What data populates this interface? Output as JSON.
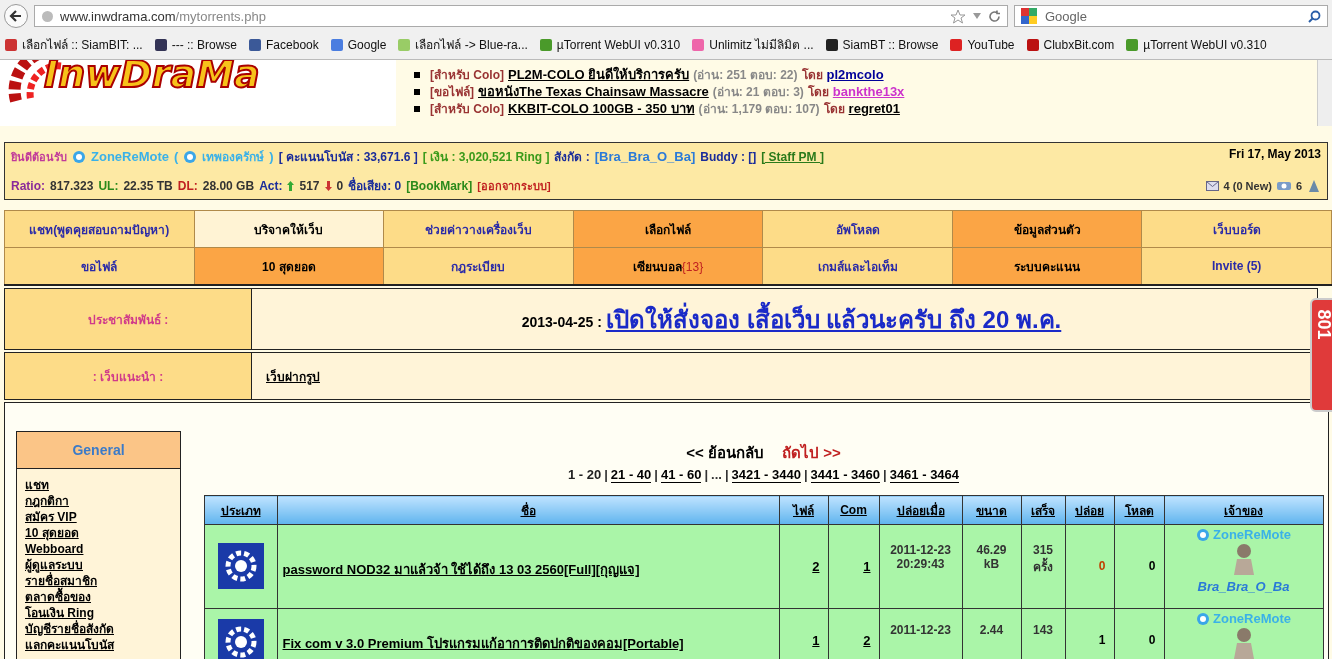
{
  "browser": {
    "address_host": "www.inwdrama.com",
    "address_path": "/mytorrents.php",
    "search_placeholder": "Google",
    "bookmarks": [
      {
        "label": "เลือกไฟล์ :: SiamBIT: ...",
        "kind": "flag"
      },
      {
        "label": "--- :: Browse",
        "kind": "shield"
      },
      {
        "label": "Facebook",
        "kind": "facebook"
      },
      {
        "label": "Google",
        "kind": "google"
      },
      {
        "label": "เลือกไฟล์ -> Blue-ra...",
        "kind": "android"
      },
      {
        "label": "µTorrent WebUI v0.310",
        "kind": "utorrent"
      },
      {
        "label": "Unlimitz ไม่มีลิมิต ...",
        "kind": "colorful"
      },
      {
        "label": "SiamBT :: Browse",
        "kind": "x"
      },
      {
        "label": "YouTube",
        "kind": "youtube"
      },
      {
        "label": "ClubxBit.com",
        "kind": "clubx"
      },
      {
        "label": "µTorrent WebUI v0.310",
        "kind": "utorrent"
      }
    ]
  },
  "logo": "InwDraMa",
  "news": [
    {
      "tag": "[สำหรับ Colo]",
      "title": "PL2M-COLO ยินดีให้บริการครับ",
      "stats": "(อ่าน: 251 ตอบ: 22)",
      "by": "โดย",
      "author": "pl2mcolo",
      "color": "#000099"
    },
    {
      "tag": "[ขอไฟล์]",
      "title": "ขอหนังThe Texas Chainsaw Massacre",
      "stats": "(อ่าน: 21 ตอบ: 3)",
      "by": "โดย",
      "author": "bankthe13x",
      "color": "#cc33cc"
    },
    {
      "tag": "[สำหรับ Colo]",
      "title": "KKBIT-COLO 100GB - 350 บาท",
      "stats": "(อ่าน: 1,179 ตอบ: 107)",
      "by": "โดย",
      "author": "regret01",
      "color": "#000000"
    }
  ],
  "user_bar": {
    "welcome": "ยินดีต้อนรับ",
    "username": "ZoneReMote",
    "rank_open": "(",
    "rank": "เทพองครักษ์",
    "rank_close": ")",
    "bonus": "[ คะแนนโบนัส : 33,671.6 ]",
    "money": "[ เงิน : 3,020,521 Ring ]",
    "clan_label": "สังกัด :",
    "clan": "[Bra_Bra_O_Ba]",
    "buddy": "Buddy : []",
    "staff_pm": "[ Staff PM ]",
    "date": "Fri 17, May 2013",
    "ratio_label": "Ratio:",
    "ratio": "817.323",
    "ul_label": "UL:",
    "ul": "22.35 TB",
    "dl_label": "DL:",
    "dl": "28.00 GB",
    "act_label": "Act:",
    "seeding": "517",
    "leeching": "0",
    "fame": "ชื่อเสียง: 0",
    "bookmark": "[BookMark]",
    "logout": "[ออกจากระบบ]",
    "messages": "4 (0 New)",
    "friends": "6"
  },
  "nav": [
    [
      {
        "label": "แชท(พูดคุยสอบถามปัญหา)",
        "kind": "normal"
      },
      {
        "label": "บริจาคให้เว็บ",
        "kind": "light"
      },
      {
        "label": "ช่วยค่าวางเครื่องเว็บ",
        "kind": "normal"
      },
      {
        "label": "เลือกไฟล์",
        "kind": "orange"
      },
      {
        "label": "อัพโหลด",
        "kind": "normal"
      },
      {
        "label": "ข้อมูลส่วนตัว",
        "kind": "orange"
      },
      {
        "label": "เว็บบอร์ด",
        "kind": "normal"
      }
    ],
    [
      {
        "label": "ขอไฟล์",
        "kind": "normal"
      },
      {
        "label": "10 สุดยอด",
        "kind": "orange"
      },
      {
        "label": "กฎระเบียบ",
        "kind": "normal"
      },
      {
        "label": "เซียนบอล",
        "count": "{13}",
        "kind": "orange"
      },
      {
        "label": "เกมส์และไอเท็ม",
        "kind": "normal"
      },
      {
        "label": "ระบบคะแนน",
        "kind": "orange"
      },
      {
        "label": "Invite (5)",
        "kind": "normal"
      }
    ]
  ],
  "announcements": [
    {
      "label": "ประชาสัมพันธ์ :",
      "date": "2013-04-25 :",
      "text": "เปิดให้สั่งจอง เสื้อเว็บ แล้วนะครับ ถึง 20 พ.ค.",
      "kind": "big"
    },
    {
      "label": ": เว็บแนะนำ :",
      "text": "เว็บฝากรูป",
      "kind": "small"
    }
  ],
  "side_tab": "801",
  "sidebar": {
    "title": "General",
    "items": [
      "แชท",
      "กฎกติกา",
      "สมัคร VIP",
      "10 สุดยอด",
      "Webboard",
      "ผู้ดูแลระบบ",
      "รายชื่อสมาชิก",
      "ตลาดซื้อของ",
      "โอนเงิน Ring",
      "บัญชีรายชื่อสังกัด",
      "แลกคะแนนโบนัส"
    ]
  },
  "pagination": {
    "prev": "<< ย้อนกลับ",
    "next": "ถัดไป >>",
    "separator": "|",
    "pages": [
      {
        "label": "1 - 20",
        "selected": true
      },
      {
        "label": "21 - 40",
        "selected": false
      },
      {
        "label": "41 - 60",
        "selected": false
      },
      {
        "label": "...",
        "kind": "gap"
      },
      {
        "label": "3421 - 3440",
        "selected": false
      },
      {
        "label": "3441 - 3460",
        "selected": false
      },
      {
        "label": "3461 - 3464",
        "selected": false
      }
    ]
  },
  "table": {
    "columns": [
      "ประเภท",
      "ชื่อ",
      "ไฟล์",
      "Com",
      "ปล่อยเมื่อ",
      "ขนาด",
      "เสร็จ",
      "ปล่อย",
      "โหลด",
      "เจ้าของ"
    ],
    "rows": [
      {
        "name": "password NOD32 มาแล้วจ้า ใช้ได้ถึง 13 03 2560[Full][กุญแจ]",
        "files": "2",
        "comments": "1",
        "date": "2011-12-23",
        "time": "20:29:43",
        "size": "46.29",
        "size_unit": "kB",
        "done": "315",
        "done_unit": "ครั้ง",
        "seeders": "0",
        "dead": true,
        "leechers": "0",
        "owner": "ZoneReMote",
        "clan": "Bra_Bra_O_Ba"
      },
      {
        "name": "Fix com v 3.0 Premium โปรแกรมแก้อาการติดปกติของคอม[Portable]",
        "files": "1",
        "comments": "2",
        "date": "2011-12-23",
        "size": "2.44",
        "done": "143",
        "seeders": "1",
        "dead": false,
        "leechers": "0",
        "owner": "ZoneReMote"
      }
    ]
  }
}
